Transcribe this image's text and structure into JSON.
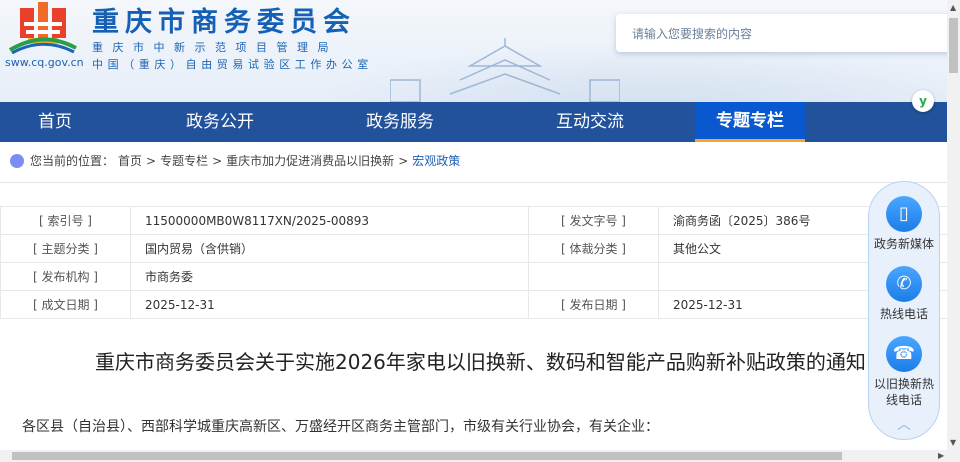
{
  "header": {
    "site_title": "重庆市商务委员会",
    "subtitle1": "重庆市中新示范项目管理局",
    "subtitle2": "中国（重庆）自由贸易试验区工作办公室",
    "url": "sww.cq.gov.cn",
    "search_placeholder": "请输入您要搜索的内容"
  },
  "nav": [
    {
      "label": "首页"
    },
    {
      "label": "政务公开"
    },
    {
      "label": "政务服务"
    },
    {
      "label": "互动交流"
    },
    {
      "label": "专题专栏",
      "active": true
    }
  ],
  "breadcrumb": {
    "prefix": "您当前的位置：",
    "items": [
      "首页",
      ">",
      "专题专栏",
      ">",
      "重庆市加力促进消费品以旧换新",
      ">"
    ],
    "current": "宏观政策"
  },
  "meta": [
    {
      "l1": "[ 索引号 ]",
      "v1": "11500000MB0W8117XN/2025-00893",
      "l2": "[ 发文字号 ]",
      "v2": "渝商务函〔2025〕386号"
    },
    {
      "l1": "[ 主题分类 ]",
      "v1": "国内贸易（含供销）",
      "l2": "[ 体裁分类 ]",
      "v2": "其他公文"
    },
    {
      "l1": "[ 发布机构 ]",
      "v1": "市商务委",
      "l2": "",
      "v2": ""
    },
    {
      "l1": "[ 成文日期 ]",
      "v1": "2025-12-31",
      "l2": "[ 发布日期 ]",
      "v2": "2025-12-31"
    }
  ],
  "doc": {
    "title": "重庆市商务委员会关于实施2026年家电以旧换新、数码和智能产品购新补贴政策的通知",
    "salutation": "各区县（自治县）、西部科学城重庆高新区、万盛经开区商务主管部门，市级有关行业协会，有关企业："
  },
  "float": {
    "items": [
      {
        "label": "政务新媒体",
        "icon": "tablet-icon"
      },
      {
        "label": "热线电话",
        "icon": "phone-icon"
      },
      {
        "label": "以旧换新热线电话",
        "icon": "telephone-icon"
      }
    ]
  },
  "colors": {
    "nav": "#22529c",
    "active": "#0a58cf",
    "accent": "#f5a623"
  }
}
